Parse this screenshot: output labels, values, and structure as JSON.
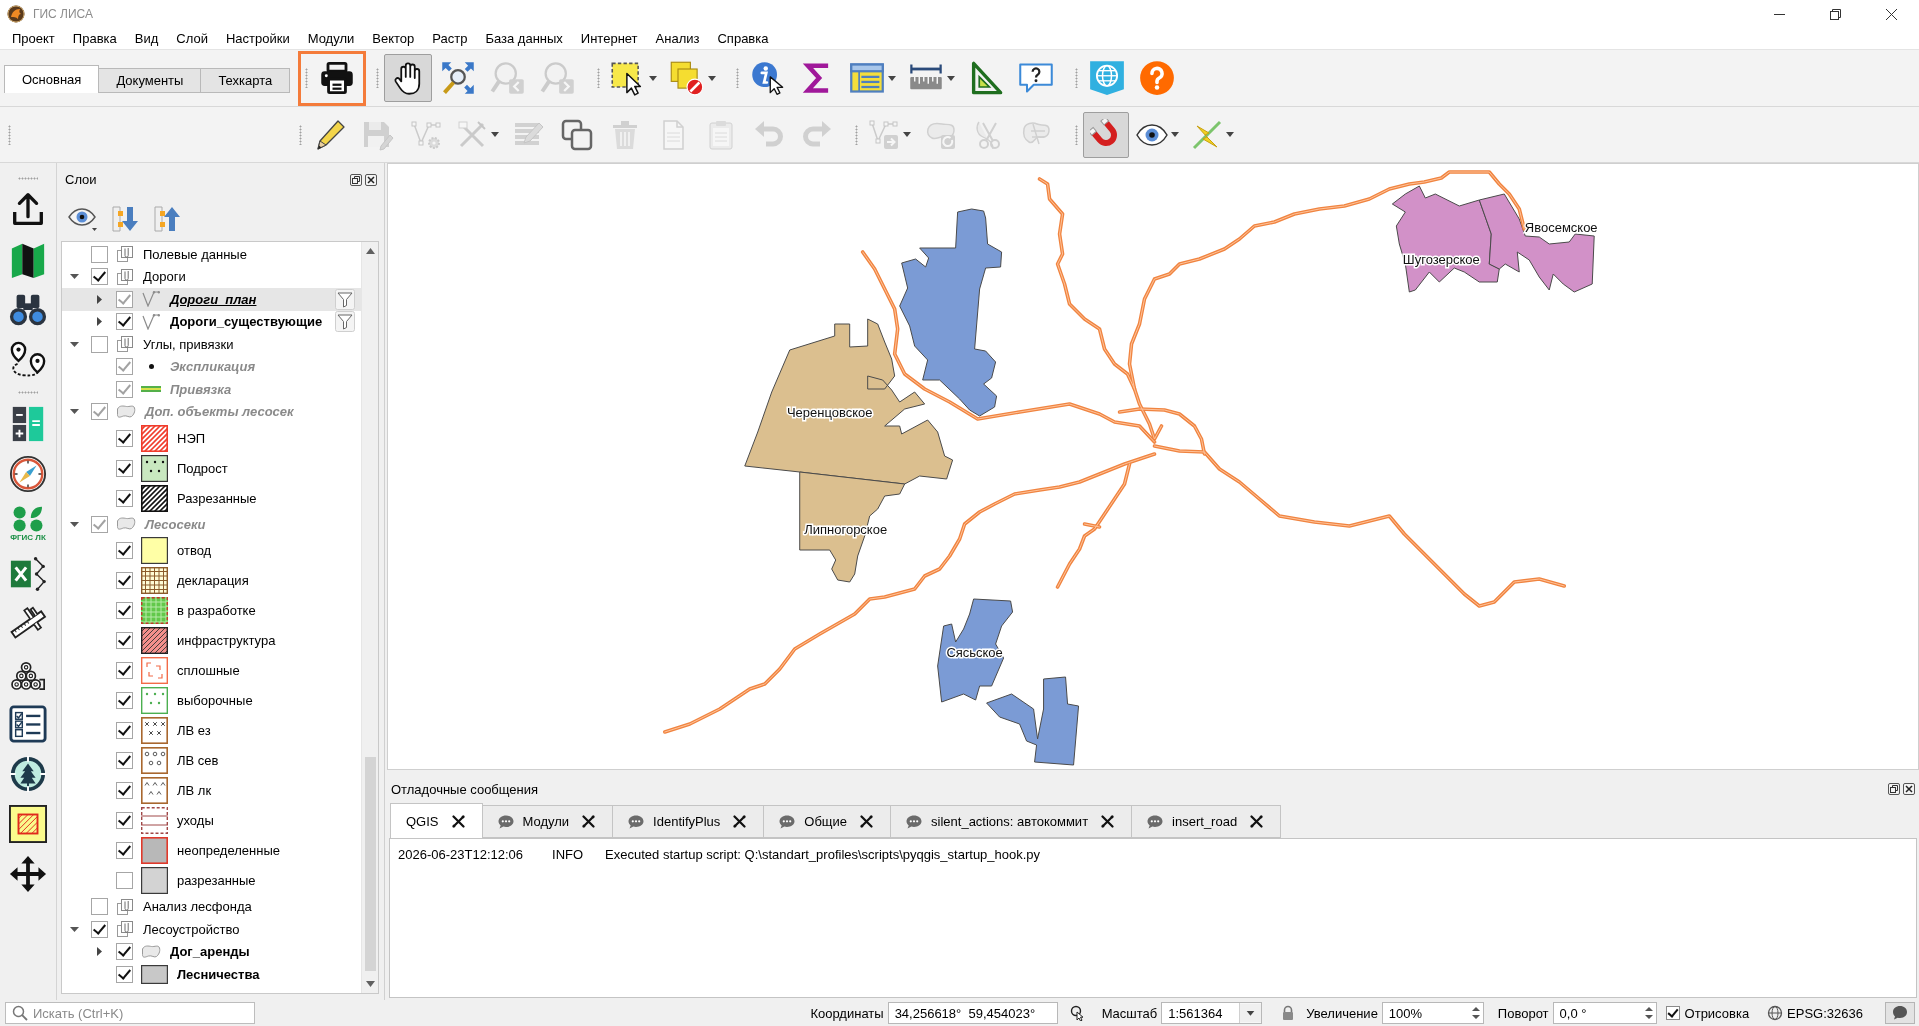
{
  "window": {
    "title": "ГИС ЛИСА"
  },
  "menu": [
    "Проект",
    "Правка",
    "Вид",
    "Слой",
    "Настройки",
    "Модули",
    "Вектор",
    "Растр",
    "База данных",
    "Интернет",
    "Анализ",
    "Справка"
  ],
  "toolbar_tabs": [
    {
      "label": "Основная",
      "selected": true
    },
    {
      "label": "Документы",
      "selected": false
    },
    {
      "label": "Техкарта",
      "selected": false
    }
  ],
  "toolbar_top": [
    {
      "highlighted": true,
      "buttons": [
        {
          "pressed": false,
          "disabled": false,
          "dropdown": false
        }
      ]
    },
    {
      "highlighted": false,
      "buttons": [
        {
          "pressed": true,
          "disabled": false,
          "dropdown": false
        },
        {
          "pressed": false,
          "disabled": false,
          "dropdown": false
        },
        {
          "pressed": false,
          "disabled": true,
          "dropdown": false
        },
        {
          "pressed": false,
          "disabled": true,
          "dropdown": false
        }
      ]
    },
    {
      "highlighted": false,
      "buttons": [
        {
          "pressed": false,
          "disabled": false,
          "dropdown": true
        },
        {
          "pressed": false,
          "disabled": false,
          "dropdown": true
        }
      ]
    },
    {
      "highlighted": false,
      "buttons": [
        {
          "pressed": false,
          "disabled": false,
          "dropdown": false
        },
        {
          "pressed": false,
          "disabled": false,
          "dropdown": false
        },
        {
          "pressed": false,
          "disabled": false,
          "dropdown": true
        },
        {
          "pressed": false,
          "disabled": false,
          "dropdown": true
        },
        {
          "pressed": false,
          "disabled": false,
          "dropdown": false
        },
        {
          "pressed": false,
          "disabled": false,
          "dropdown": false
        }
      ]
    },
    {
      "highlighted": false,
      "buttons": [
        {
          "pressed": false,
          "disabled": false,
          "dropdown": false
        },
        {
          "pressed": false,
          "disabled": false,
          "dropdown": false
        }
      ]
    }
  ],
  "toolbar_bottom": [
    {
      "highlighted": false,
      "buttons": [
        {
          "pressed": false,
          "disabled": false,
          "dropdown": false
        },
        {
          "pressed": false,
          "disabled": true,
          "dropdown": false
        },
        {
          "pressed": false,
          "disabled": true,
          "dropdown": false
        },
        {
          "pressed": false,
          "disabled": true,
          "dropdown": true
        },
        {
          "pressed": false,
          "disabled": true,
          "dropdown": false
        },
        {
          "pressed": false,
          "disabled": false,
          "dropdown": false
        },
        {
          "pressed": false,
          "disabled": true,
          "dropdown": false
        },
        {
          "pressed": false,
          "disabled": true,
          "dropdown": false
        },
        {
          "pressed": false,
          "disabled": true,
          "dropdown": false
        },
        {
          "pressed": false,
          "disabled": true,
          "dropdown": false
        },
        {
          "pressed": false,
          "disabled": true,
          "dropdown": false
        }
      ]
    },
    {
      "highlighted": false,
      "buttons": [
        {
          "pressed": false,
          "disabled": true,
          "dropdown": true
        },
        {
          "pressed": false,
          "disabled": true,
          "dropdown": false
        },
        {
          "pressed": false,
          "disabled": true,
          "dropdown": false
        },
        {
          "pressed": false,
          "disabled": true,
          "dropdown": false
        }
      ]
    },
    {
      "highlighted": false,
      "buttons": [
        {
          "pressed": true,
          "disabled": false,
          "dropdown": false
        },
        {
          "pressed": false,
          "disabled": false,
          "dropdown": true
        },
        {
          "pressed": false,
          "disabled": false,
          "dropdown": true
        }
      ]
    }
  ],
  "left_toolbar": {
    "logo_label": "ФГИС ЛК"
  },
  "layers_panel": {
    "title": "Слои",
    "layers": [
      {
        "name": "Полевые данные",
        "kind": "group",
        "checked": false,
        "in_scale": true,
        "active": false,
        "dimmed": false,
        "selected": false,
        "filtered": false
      },
      {
        "name": "Дороги",
        "kind": "group",
        "checked": true,
        "in_scale": true,
        "active": false,
        "dimmed": false,
        "selected": false,
        "filtered": false,
        "expanded": true,
        "children": [
          {
            "name": "Дороги_план",
            "kind": "line-layer",
            "checked": true,
            "in_scale": false,
            "active": true,
            "dimmed": false,
            "selected": true,
            "filtered": true,
            "expanded": false
          },
          {
            "name": "Дороги_существующие",
            "kind": "line-layer",
            "checked": true,
            "in_scale": true,
            "active": false,
            "dimmed": false,
            "selected": false,
            "filtered": true,
            "expanded": false
          }
        ]
      },
      {
        "name": "Углы, привязки",
        "kind": "group",
        "checked": false,
        "in_scale": true,
        "active": false,
        "dimmed": false,
        "selected": false,
        "filtered": false,
        "expanded": true,
        "children": [
          {
            "name": "Экспликация",
            "kind": "point",
            "checked": true,
            "in_scale": false,
            "active": false,
            "dimmed": true,
            "selected": false,
            "filtered": false
          },
          {
            "name": "Привязка",
            "kind": "line",
            "checked": true,
            "in_scale": false,
            "active": false,
            "dimmed": true,
            "selected": false,
            "filtered": false
          }
        ]
      },
      {
        "name": "Доп. объекты лесосек",
        "kind": "polygon-layer",
        "checked": true,
        "in_scale": false,
        "active": false,
        "dimmed": true,
        "selected": false,
        "filtered": false,
        "expanded": true,
        "children": [
          {
            "name": "НЭП",
            "kind": "hatch",
            "color": "#f03c2c",
            "checked": true,
            "in_scale": true,
            "active": false,
            "dimmed": false,
            "selected": false,
            "filtered": false
          },
          {
            "name": "Подрост",
            "kind": "dotted-fill",
            "color": "#c9e8c0",
            "checked": true,
            "in_scale": true,
            "active": false,
            "dimmed": false,
            "selected": false,
            "filtered": false
          },
          {
            "name": "Разрезанные",
            "kind": "hatch",
            "color": "#111111",
            "checked": true,
            "in_scale": true,
            "active": false,
            "dimmed": false,
            "selected": false,
            "filtered": false
          }
        ]
      },
      {
        "name": "Лесосеки",
        "kind": "polygon-layer",
        "checked": true,
        "in_scale": false,
        "active": false,
        "dimmed": true,
        "selected": false,
        "filtered": false,
        "expanded": true,
        "children": [
          {
            "name": "отвод",
            "kind": "solid",
            "color": "#ffffa6",
            "checked": true,
            "in_scale": true,
            "active": false,
            "dimmed": false,
            "selected": false,
            "filtered": false
          },
          {
            "name": "декларация",
            "kind": "grid",
            "color": "#8b5a2b",
            "checked": true,
            "in_scale": true,
            "active": false,
            "dimmed": false,
            "selected": false,
            "filtered": false
          },
          {
            "name": "в разработке",
            "kind": "filled-grid",
            "color": "#62c94a",
            "checked": true,
            "in_scale": true,
            "active": false,
            "dimmed": false,
            "selected": false,
            "filtered": false
          },
          {
            "name": "инфраструктура",
            "kind": "filled-hatch",
            "color": "#f4908c",
            "checked": true,
            "in_scale": true,
            "active": false,
            "dimmed": false,
            "selected": false,
            "filtered": false
          },
          {
            "name": "сплошные",
            "kind": "corners",
            "color": "#f26b48",
            "checked": true,
            "in_scale": true,
            "active": false,
            "dimmed": false,
            "selected": false,
            "filtered": false
          },
          {
            "name": "выборочные",
            "kind": "dots",
            "color": "#4caf50",
            "checked": true,
            "in_scale": true,
            "active": false,
            "dimmed": false,
            "selected": false,
            "filtered": false
          },
          {
            "name": "ЛВ ез",
            "kind": "crosses",
            "color": "#a8672e",
            "checked": true,
            "in_scale": true,
            "active": false,
            "dimmed": false,
            "selected": false,
            "filtered": false
          },
          {
            "name": "ЛВ сев",
            "kind": "circles",
            "color": "#a8672e",
            "checked": true,
            "in_scale": true,
            "active": false,
            "dimmed": false,
            "selected": false,
            "filtered": false
          },
          {
            "name": "ЛВ лк",
            "kind": "carets",
            "color": "#a8672e",
            "checked": true,
            "in_scale": true,
            "active": false,
            "dimmed": false,
            "selected": false,
            "filtered": false
          },
          {
            "name": "уходы",
            "kind": "lines",
            "color": "#a04848",
            "checked": true,
            "in_scale": true,
            "active": false,
            "dimmed": false,
            "selected": false,
            "filtered": false
          },
          {
            "name": "неопределенные",
            "kind": "outlined",
            "color": "#b8b8b8",
            "checked": true,
            "in_scale": true,
            "active": false,
            "dimmed": false,
            "selected": false,
            "filtered": false
          },
          {
            "name": "разрезанные",
            "kind": "solid",
            "color": "#d3d3d3",
            "checked": false,
            "in_scale": true,
            "active": false,
            "dimmed": false,
            "selected": false,
            "filtered": false
          }
        ]
      },
      {
        "name": "Анализ лесфонда",
        "kind": "group",
        "checked": false,
        "in_scale": true,
        "active": false,
        "dimmed": false,
        "selected": false,
        "filtered": false
      },
      {
        "name": "Лесоустройство",
        "kind": "group",
        "checked": true,
        "in_scale": true,
        "active": false,
        "dimmed": false,
        "selected": false,
        "filtered": false,
        "expanded": true,
        "children": [
          {
            "name": "Дог_аренды",
            "kind": "polygon-layer",
            "checked": true,
            "in_scale": true,
            "active": false,
            "dimmed": false,
            "selected": false,
            "filtered": false,
            "expanded": false
          },
          {
            "name": "Лесничества",
            "kind": "solid",
            "color": "#c8c8c8",
            "checked": true,
            "in_scale": true,
            "active": false,
            "dimmed": false,
            "selected": false,
            "filtered": false
          }
        ]
      }
    ]
  },
  "map": {
    "regions": [
      {
        "label": "Черенцовское",
        "color": "#dbbf8f"
      },
      {
        "label": "Липногорское",
        "color": "#dbbf8f"
      },
      {
        "color": "#7b9bd5"
      },
      {
        "label": "Сясьское",
        "color": "#7b9bd5"
      },
      {
        "label": "Шугозерское",
        "color": "#d291c8"
      },
      {
        "label": "Явосемское",
        "color": "#d291c8"
      }
    ]
  },
  "log_panel": {
    "title": "Отладочные сообщения",
    "tabs": [
      {
        "label": "QGIS",
        "selected": true,
        "unread": false
      },
      {
        "label": "Модули",
        "selected": false,
        "unread": true
      },
      {
        "label": "IdentifyPlus",
        "selected": false,
        "unread": true
      },
      {
        "label": "Общие",
        "selected": false,
        "unread": true
      },
      {
        "label": "silent_actions: автокоммит",
        "selected": false,
        "unread": true
      },
      {
        "label": "insert_road",
        "selected": false,
        "unread": true
      }
    ],
    "messages": [
      {
        "time": "2026-06-23T12:12:06",
        "level": "INFO",
        "text": "Executed startup script: Q:\\standart_profiles\\scripts\\pyqgis_startup_hook.py"
      }
    ]
  },
  "status_bar": {
    "search": {
      "placeholder": "Искать (Ctrl+K)"
    },
    "coordinates_label": "Координаты",
    "coordinates": "34,256618°  59,454023°",
    "scale_label": "Масштаб",
    "scale": "1:561364",
    "magnifier_label": "Увеличение",
    "magnifier": "100%",
    "rotation_label": "Поворот",
    "rotation": "0,0 °",
    "render": {
      "label": "Отрисовка",
      "checked": true
    },
    "crs": "EPSG:32636"
  }
}
